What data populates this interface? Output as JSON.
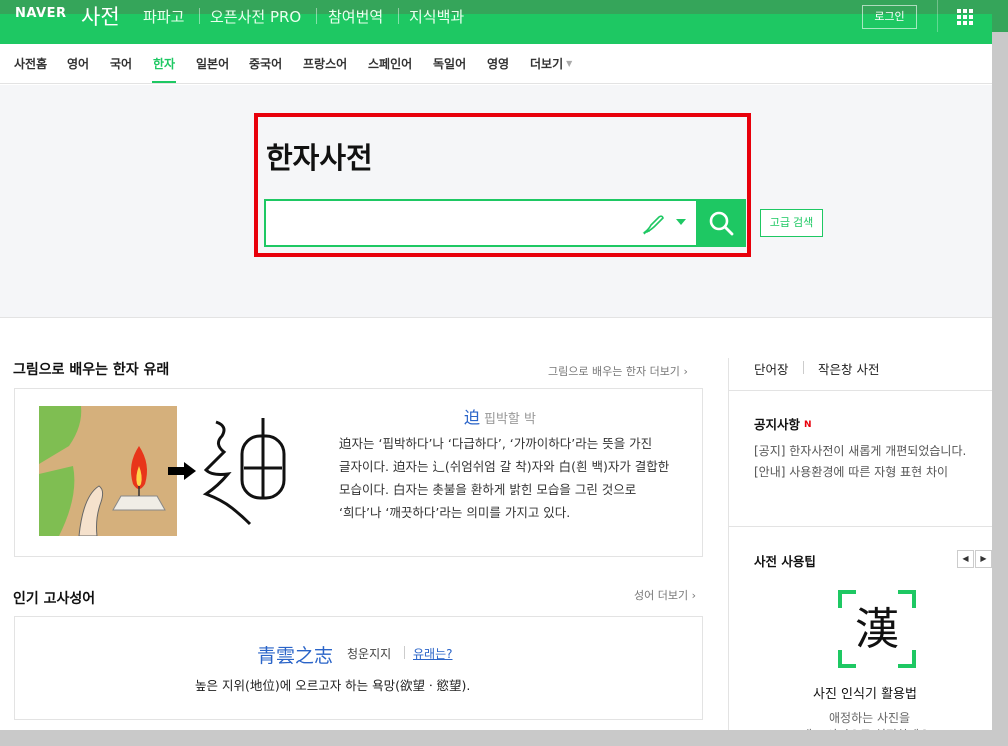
{
  "header": {
    "logo": "NAVER",
    "service": "사전",
    "nav": [
      "파파고",
      "오픈사전 PRO",
      "참여번역",
      "지식백과"
    ],
    "login": "로그인",
    "menu_icon": "grid-icon"
  },
  "tabs": {
    "items": [
      "사전홈",
      "영어",
      "국어",
      "한자",
      "일본어",
      "중국어",
      "프랑스어",
      "스페인어",
      "독일어",
      "영영",
      "더보기"
    ],
    "active": "한자"
  },
  "search": {
    "title": "한자사전",
    "placeholder": "",
    "handwriting_icon": "pen-icon",
    "button_icon": "search-icon",
    "advanced": "고급 검색"
  },
  "origin_section": {
    "title": "그림으로 배우는 한자 유래",
    "more": "그림으로 배우는 한자 더보기",
    "char": "迫",
    "reading": "핍박할 박",
    "description": "迫자는 ‘핍박하다’나 ‘다급하다’, ‘가까이하다’라는 뜻을 가진 글자이다. 迫자는 辶(쉬엄쉬엄 갈 착)자와 白(흰 백)자가 결합한 모습이다. 白자는 촛불을 환하게 밝힌 모습을 그린 것으로 ‘희다’나 ‘깨끗하다’라는 의미를 가지고 있다."
  },
  "idiom_section": {
    "title": "인기 고사성어",
    "more": "성어 더보기",
    "hanja": "青雲之志",
    "reading": "청운지지",
    "origin_link": "유래는?",
    "meaning": "높은 지위(地位)에 오르고자 하는 욕망(欲望ㆍ慾望)."
  },
  "sidebar": {
    "tabs": [
      "단어장",
      "작은창 사전"
    ],
    "notice_title": "공지사항",
    "notice_badge": "N",
    "notices": [
      "[공지] 한자사전이 새롭게 개편되었습니다.",
      "[안내] 사용환경에 따른 자형 표현 차이"
    ],
    "tip_title": "사전 사용팁",
    "tip_icon_char": "漢",
    "tip_name": "사진 인식기 활용법",
    "tip_desc1": "애정하는 사진을",
    "tip_desc2": "대표 사진으로 설정하세요."
  },
  "colors": {
    "brand": "#1ec863",
    "highlight": "#e8000b",
    "link": "#2a64c8"
  }
}
